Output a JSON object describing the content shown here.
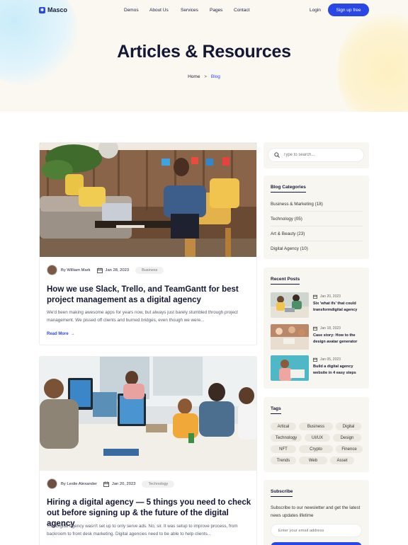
{
  "nav": {
    "brand": "Masco",
    "links": [
      "Demos",
      "About Us",
      "Services",
      "Pages",
      "Contact"
    ],
    "login": "Login",
    "signup": "Sign up free"
  },
  "hero": {
    "title": "Articles & Resources",
    "breadcrumb": {
      "home": "Home",
      "separator": ">",
      "current": "Blog"
    }
  },
  "posts": [
    {
      "author": "By William Mark",
      "date": "Jan 28, 2023",
      "tag": "Business",
      "title": "How we use Slack, Trello, and TeamGantt for best project management as a digital agency",
      "excerpt": "We'd been making awesome apps for years now, but always just barely stumbled through project management. We pissed off clients and burned bridges, even though we were...",
      "read_more": "Read More"
    },
    {
      "author": "By Leslie Alexander",
      "date": "Jan 20, 2023",
      "tag": "Technology",
      "title": "Hiring a digital agency — 5 things you need to check out before signing up & the future of the digital agency",
      "excerpt": "The Digital Agency wasn't set up to only serve ads. No, sir. It was setup to improve process, from backroom to front desk marketing. Digital agencies need to be able to help clients..."
    }
  ],
  "sidebar": {
    "search_placeholder": "Type to search...",
    "categories_title": "Blog Categories",
    "categories": [
      "Business & Marketing (18)",
      "Technology (05)",
      "Art & Beauty (23)",
      "Digital Agency (10)"
    ],
    "recent_title": "Recent Posts",
    "recent": [
      {
        "date": "Jan 20, 2023",
        "title": "Six 'what ifs' that could transformdigital agency"
      },
      {
        "date": "Jan 18, 2023",
        "title": "Case story: How to the design avatar generator"
      },
      {
        "date": "Jan 05, 2023",
        "title": "Build a digital agency website in 4 easy steps"
      }
    ],
    "tags_title": "Tags",
    "tags": [
      "Artical",
      "Business",
      "Digital",
      "Technology",
      "UI/UX",
      "Design",
      "NFT",
      "Crypto",
      "Finence",
      "Trends",
      "Web",
      "Asset"
    ],
    "subscribe_title": "Subscribe",
    "subscribe_text": "Subscribe to our newsletter and get the latest news updates lifetime",
    "email_placeholder": "Enter your email address"
  },
  "colors": {
    "accent": "#2947e6",
    "hero_bg": "#fbf8f2",
    "sidebar_bg": "#f8f6f0"
  }
}
